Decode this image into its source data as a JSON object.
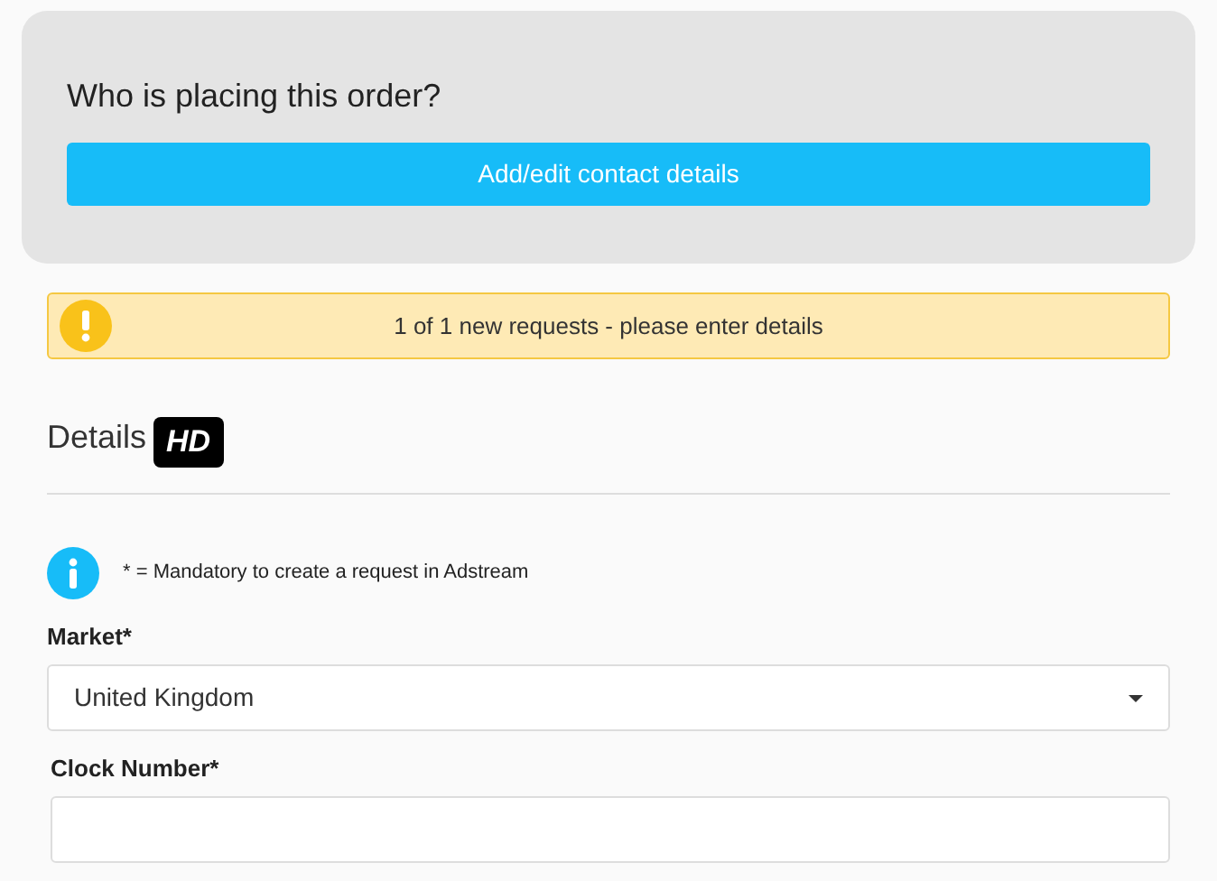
{
  "contact": {
    "title": "Who is placing this order?",
    "button": "Add/edit contact details"
  },
  "alert": {
    "text": "1 of 1 new requests - please enter details"
  },
  "details": {
    "heading": "Details",
    "badge": "HD"
  },
  "note": {
    "text": "* = Mandatory to create a request in Adstream"
  },
  "fields": [
    {
      "kind": "select",
      "label": "Market*",
      "value": "United Kingdom"
    },
    {
      "kind": "text",
      "label": "Clock Number*"
    }
  ]
}
